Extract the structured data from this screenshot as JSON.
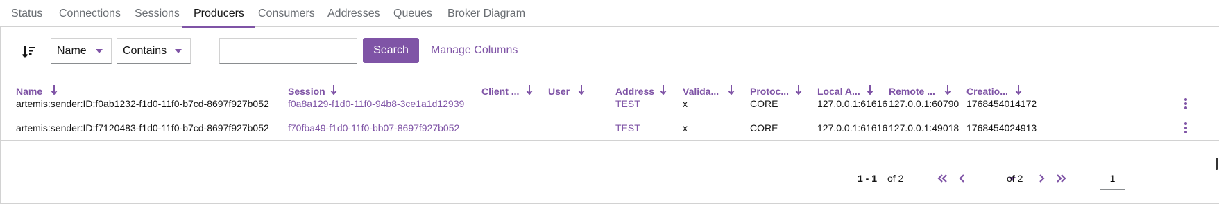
{
  "tabs": [
    "Status",
    "Connections",
    "Sessions",
    "Producers",
    "Consumers",
    "Addresses",
    "Queues",
    "Broker Diagram"
  ],
  "active_tab": "Producers",
  "toolbar": {
    "filter_field": "Name",
    "filter_operator": "Contains",
    "search_value": "",
    "search_label": "Search",
    "manage_columns_label": "Manage Columns"
  },
  "table": {
    "columns": [
      "Name",
      "Session",
      "Client ...",
      "User",
      "Address",
      "Valida...",
      "Protoc...",
      "Local A...",
      "Remote ...",
      "Creatio..."
    ],
    "rows": [
      {
        "name": "artemis:sender:ID:f0ab1232-f1d0-11f0-b7cd-8697f927b052",
        "session": "f0a8a129-f1d0-11f0-94b8-3ce1a1d12939",
        "client": "",
        "user": "",
        "address": "TEST",
        "validated": "x",
        "protocol": "CORE",
        "local_address": "127.0.0.1:61616",
        "remote_address": "127.0.0.1:60790",
        "creation": "1768454014172"
      },
      {
        "name": "artemis:sender:ID:f7120483-f1d0-11f0-b7cd-8697f927b052",
        "session": "f70fba49-f1d0-11f0-bb07-8697f927b052",
        "client": "",
        "user": "",
        "address": "TEST",
        "validated": "x",
        "protocol": "CORE",
        "local_address": "127.0.0.1:61616",
        "remote_address": "127.0.0.1:49018",
        "creation": "1768454024913"
      }
    ]
  },
  "pagination": {
    "range": "1 - 1",
    "of_total": "of 2",
    "page": "1",
    "of_pages": "of 2"
  },
  "colors": {
    "accent": "#7f54a6",
    "border": "#d2d2d2",
    "muted_text": "#6a6e73"
  },
  "icons": [
    "sort-amount-icon",
    "caret-down-icon",
    "arrow-down-icon",
    "kebab-icon",
    "angle-double-left-icon",
    "angle-left-icon",
    "angle-right-icon",
    "angle-double-right-icon"
  ]
}
